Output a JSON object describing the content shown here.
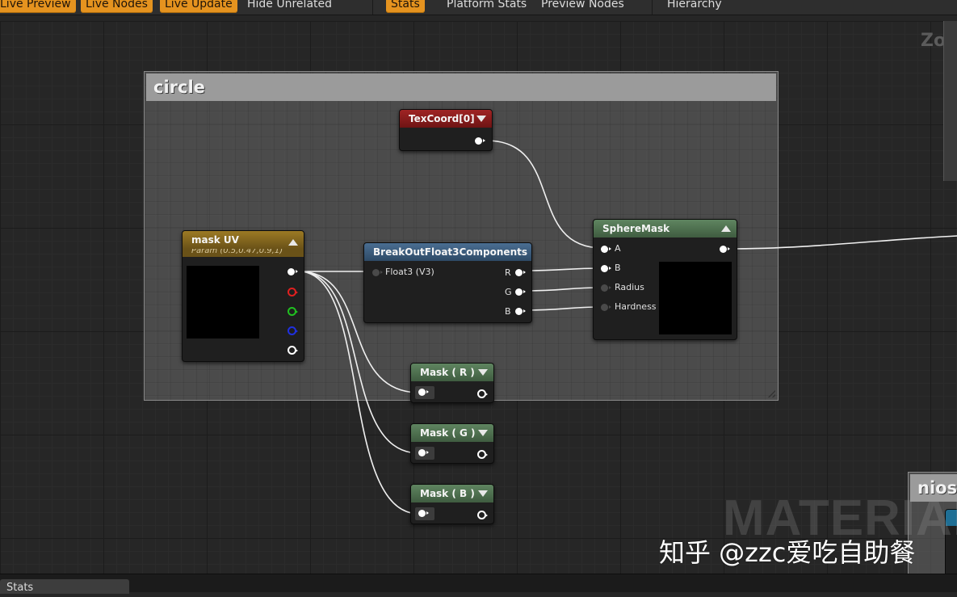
{
  "toolbar": {
    "live_preview": "Live Preview",
    "live_nodes": "Live Nodes",
    "live_update": "Live Update",
    "hide_unrelated": "Hide Unrelated",
    "stats": "Stats",
    "platform_stats": "Platform Stats",
    "preview_nodes": "Preview Nodes",
    "hierarchy": "Hierarchy"
  },
  "graph": {
    "zoom_label": "Zoom",
    "watermark": "MATERIAL",
    "comment": {
      "title": "circle"
    },
    "comment2": {
      "title": "niose"
    },
    "nodes": {
      "texcoord": {
        "title": "TexCoord[0]"
      },
      "mask_uv": {
        "title": "mask UV",
        "subtitle": "Param (0.5,0.47,0.9,1)"
      },
      "breakout": {
        "title": "BreakOutFloat3Components",
        "input": "Float3 (V3)",
        "outputs": [
          "R",
          "G",
          "B"
        ]
      },
      "spheremask": {
        "title": "SphereMask",
        "inputs": [
          "A",
          "B",
          "Radius",
          "Hardness"
        ]
      },
      "mask_r": {
        "title": "Mask ( R )"
      },
      "mask_g": {
        "title": "Mask ( G )"
      },
      "mask_b": {
        "title": "Mask ( B )"
      }
    }
  },
  "brand_watermark": "知乎 @zzc爱吃自助餐",
  "bottom": {
    "stats_tab": "Stats"
  },
  "colors": {
    "toolbar_active": "#e5931f",
    "texcoord_header": "#8a1a1a",
    "param_header": "#8a6a1a",
    "breakout_header": "#3a5a7a",
    "math_header": "#4a6a48"
  }
}
